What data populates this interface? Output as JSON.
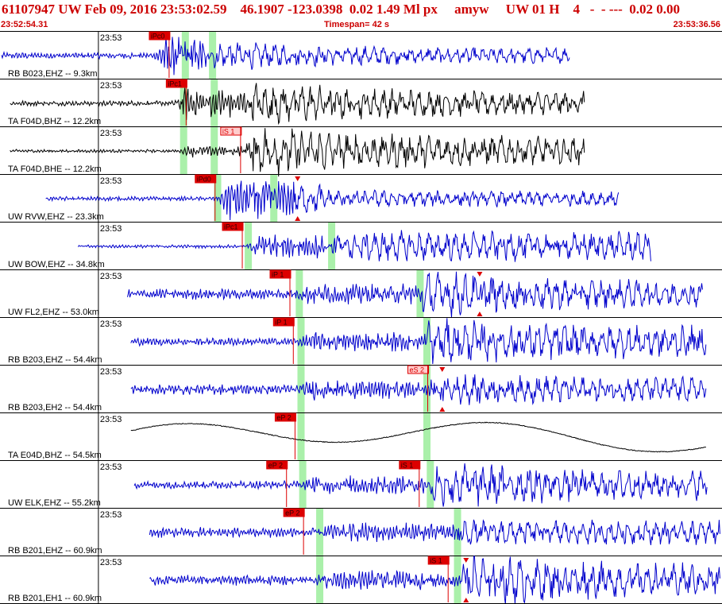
{
  "header": {
    "title": "61107947 UW Feb 09, 2016 23:53:02.59    46.1907 -123.0398  0.02 1.49 Ml px     amyw     UW 01 H    4   -  - ---  0.02 0.00",
    "start_time": "23:52:54.31",
    "timespan": "Timespan=  42 s",
    "end_time": "23:53:36.56"
  },
  "colors": {
    "waveform_blue": "#0000cc",
    "waveform_black": "#000000",
    "pick_red": "#dd0000",
    "pick_pink": "#ffcccc",
    "theoretical_green": "#aaf0aa",
    "header_red": "#cc0000"
  },
  "chart_data": {
    "type": "line",
    "title": "61107947 UW Feb 09, 2016 23:53:02.59",
    "xlabel": "Timespan=  42 s",
    "x_range_seconds": [
      0,
      42.25
    ],
    "x_start": "23:52:54.31",
    "x_end": "23:53:36.56",
    "tick_label": "23:53",
    "tick_time_s": 5.69,
    "traces": [
      {
        "label": "RB B023,EHZ -- 9.3km",
        "color": "blue",
        "start_s": 0,
        "end_s": 33.4,
        "p_time_s": 9.0,
        "s_time_s": 11.8,
        "amp": 0.18,
        "env": [
          0.12,
          0.9,
          0.55,
          0.3
        ],
        "theory": [
          10.8,
          12.4
        ],
        "picks": [
          {
            "label": "iPc0",
            "time_s": 9.8,
            "style": "red"
          }
        ],
        "markers": []
      },
      {
        "label": "TA F04D,BHZ -- 12.2km",
        "color": "black",
        "start_s": 0.5,
        "end_s": 34.3,
        "p_time_s": 10.1,
        "s_time_s": 14.7,
        "amp": 0.08,
        "env": [
          0.1,
          0.7,
          0.8,
          0.45
        ],
        "theory": [
          10.7,
          12.5
        ],
        "picks": [
          {
            "label": "iPc1",
            "time_s": 10.8,
            "style": "red"
          }
        ],
        "markers": []
      },
      {
        "label": "TA F04D,BHE -- 12.2km",
        "color": "black",
        "start_s": 0.5,
        "end_s": 34.3,
        "p_time_s": 10.4,
        "s_time_s": 14.4,
        "amp": 0.08,
        "env": [
          0.06,
          0.25,
          0.95,
          0.55
        ],
        "theory": [
          10.7,
          12.5
        ],
        "picks": [
          {
            "label": "iS 1",
            "time_s": 14.0,
            "style": "pink"
          }
        ],
        "markers": []
      },
      {
        "label": "UW RVW,EHZ -- 23.3km",
        "color": "blue",
        "start_s": 2.6,
        "end_s": 36.3,
        "p_time_s": 12.7,
        "s_time_s": 17.2,
        "amp": 0.15,
        "env": [
          0.08,
          0.95,
          0.35,
          0.3
        ],
        "theory": [
          12.7,
          16.0
        ],
        "picks": [
          {
            "label": "iPd0",
            "time_s": 12.5,
            "style": "red"
          }
        ],
        "markers": [
          17.4
        ]
      },
      {
        "label": "UW BOW,EHZ -- 34.8km",
        "color": "blue",
        "start_s": 4.5,
        "end_s": 38.2,
        "p_time_s": 14.4,
        "s_time_s": 19.7,
        "amp": 0.1,
        "env": [
          0.06,
          0.55,
          0.6,
          0.55
        ],
        "theory": [
          14.5,
          19.4
        ],
        "picks": [
          {
            "label": "iPc1",
            "time_s": 14.1,
            "style": "red"
          }
        ],
        "markers": []
      },
      {
        "label": "UW FL2,EHZ -- 53.0km",
        "color": "blue",
        "start_s": 7.4,
        "end_s": 41.2,
        "p_time_s": 17.4,
        "s_time_s": 24.7,
        "amp": 0.22,
        "env": [
          0.2,
          0.5,
          0.85,
          0.5
        ],
        "theory": [
          17.5,
          24.6
        ],
        "picks": [
          {
            "label": "iP 1",
            "time_s": 16.9,
            "style": "red"
          }
        ],
        "markers": [
          28.1
        ]
      },
      {
        "label": "RB B203,EHZ -- 54.4km",
        "color": "blue",
        "start_s": 7.6,
        "end_s": 41.4,
        "p_time_s": 17.6,
        "s_time_s": 25.0,
        "amp": 0.15,
        "env": [
          0.15,
          0.45,
          0.85,
          0.6
        ],
        "theory": [
          17.6,
          25.0
        ],
        "picks": [
          {
            "label": "iP 1",
            "time_s": 17.1,
            "style": "red"
          }
        ],
        "markers": []
      },
      {
        "label": "RB B203,EH2 -- 54.4km",
        "color": "blue",
        "start_s": 7.6,
        "end_s": 41.4,
        "p_time_s": 17.6,
        "s_time_s": 25.8,
        "amp": 0.15,
        "env": [
          0.2,
          0.45,
          0.6,
          0.45
        ],
        "theory": [
          17.6,
          25.0
        ],
        "picks": [
          {
            "label": "eS 2",
            "time_s": 25.0,
            "style": "pink"
          }
        ],
        "markers": [
          25.9
        ]
      },
      {
        "label": "TA E04D,BHZ -- 54.5km",
        "color": "black",
        "start_s": 7.6,
        "end_s": 41.4,
        "p_time_s": 17.6,
        "s_time_s": 25.0,
        "amp": 0.0,
        "env": [
          0,
          0,
          0,
          0
        ],
        "long_period": true,
        "theory": [
          17.6,
          25.0
        ],
        "picks": [
          {
            "label": "eP 2",
            "time_s": 17.2,
            "style": "red"
          }
        ],
        "markers": []
      },
      {
        "label": "UW ELK,EHZ -- 55.2km",
        "color": "blue",
        "start_s": 7.8,
        "end_s": 41.5,
        "p_time_s": 17.7,
        "s_time_s": 25.2,
        "amp": 0.18,
        "env": [
          0.15,
          0.45,
          0.9,
          0.55
        ],
        "theory": [
          17.7,
          25.2
        ],
        "picks": [
          {
            "label": "eP 2",
            "time_s": 16.7,
            "style": "red"
          },
          {
            "label": "iS 1",
            "time_s": 24.5,
            "style": "red"
          }
        ],
        "markers": []
      },
      {
        "label": "RB B201,EHZ -- 60.9km",
        "color": "blue",
        "start_s": 8.7,
        "end_s": 42.25,
        "p_time_s": 18.7,
        "s_time_s": 26.9,
        "amp": 0.1,
        "env": [
          0.2,
          0.45,
          0.5,
          0.45
        ],
        "theory": [
          18.7,
          26.8
        ],
        "picks": [
          {
            "label": "eP 2",
            "time_s": 17.7,
            "style": "red"
          }
        ],
        "markers": []
      },
      {
        "label": "RB B201,EH1 -- 60.9km",
        "color": "blue",
        "start_s": 8.7,
        "end_s": 42.25,
        "p_time_s": 18.7,
        "s_time_s": 27.1,
        "amp": 0.1,
        "env": [
          0.2,
          0.45,
          0.95,
          0.6
        ],
        "theory": [
          18.7,
          26.8
        ],
        "picks": [
          {
            "label": "iS 1",
            "time_s": 26.2,
            "style": "red"
          }
        ],
        "markers": [
          27.3
        ]
      }
    ]
  }
}
